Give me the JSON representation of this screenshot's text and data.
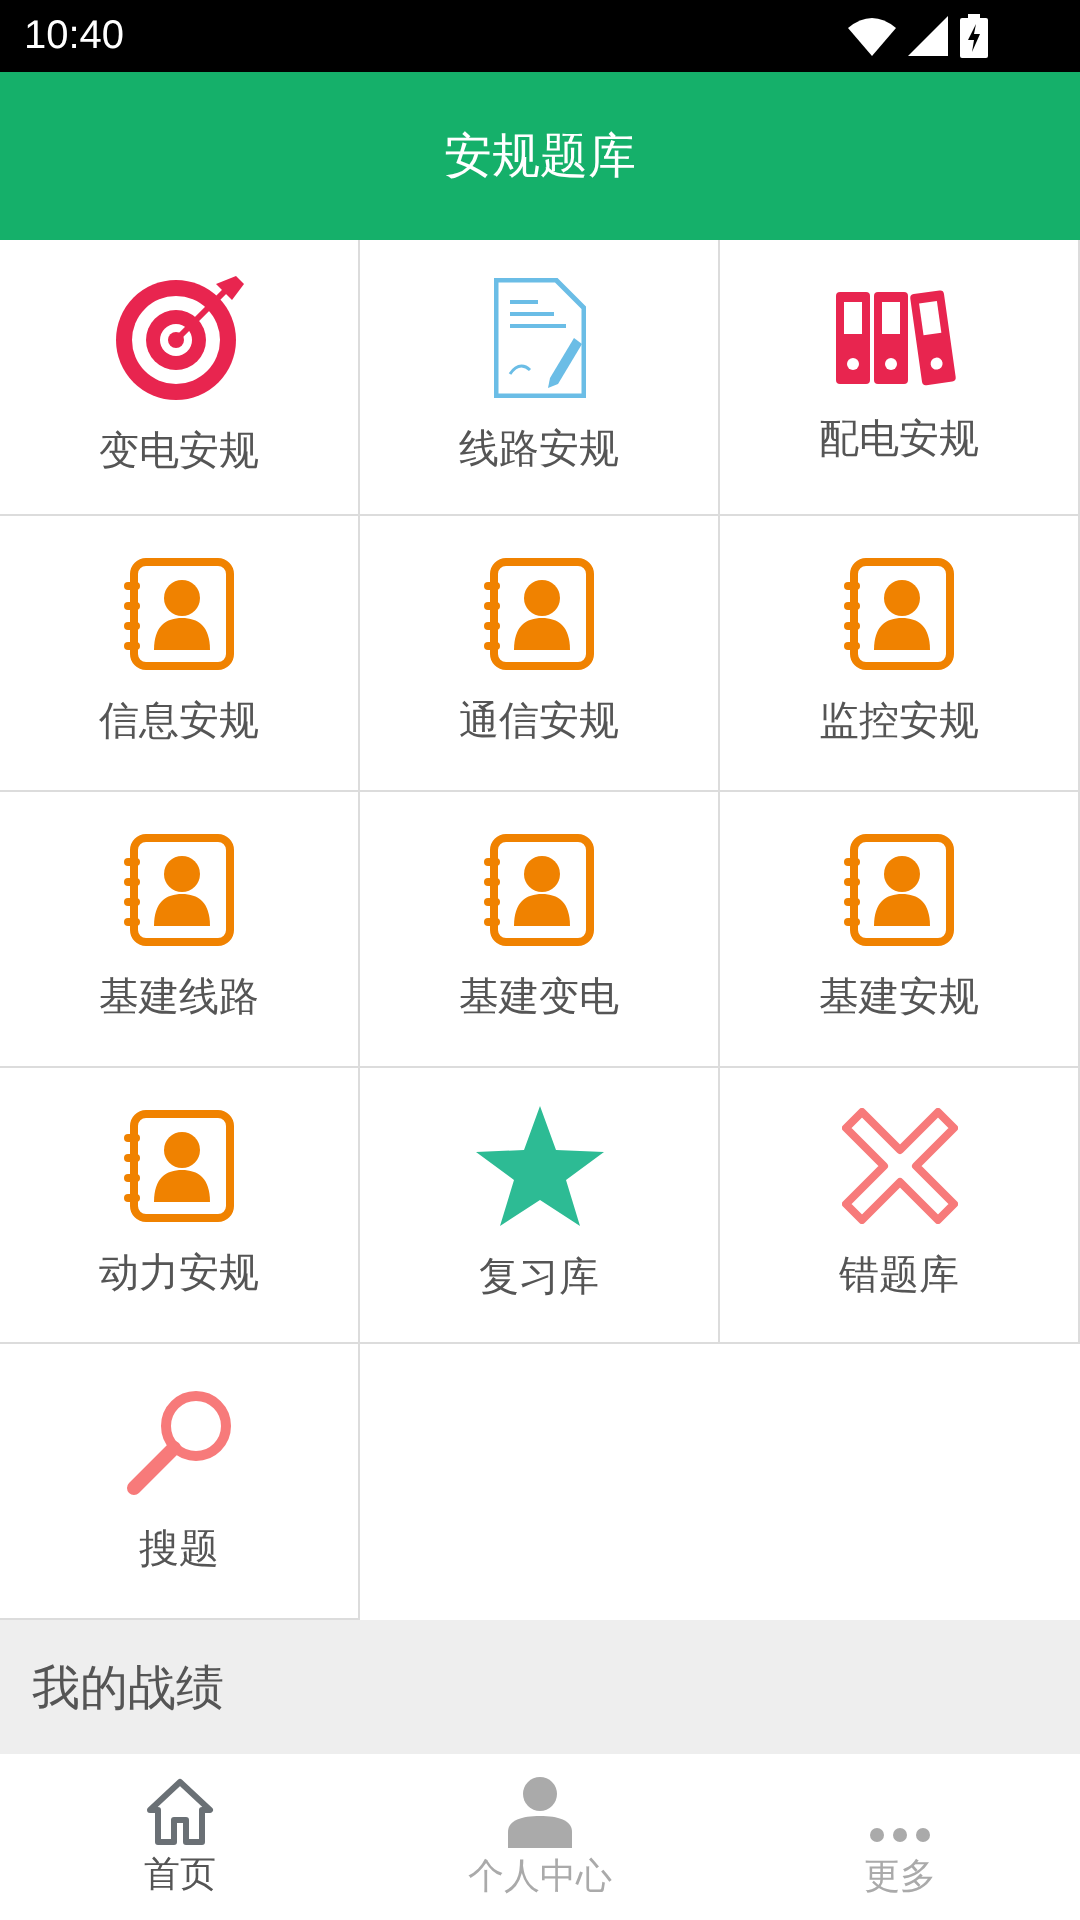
{
  "status_bar": {
    "time": "10:40"
  },
  "header": {
    "title": "安规题库"
  },
  "grid": [
    {
      "label": "变电安规",
      "kind": "target"
    },
    {
      "label": "线路安规",
      "kind": "document"
    },
    {
      "label": "配电安规",
      "kind": "binders"
    },
    {
      "label": "信息安规",
      "kind": "contact"
    },
    {
      "label": "通信安规",
      "kind": "contact"
    },
    {
      "label": "监控安规",
      "kind": "contact"
    },
    {
      "label": "基建线路",
      "kind": "contact"
    },
    {
      "label": "基建变电",
      "kind": "contact"
    },
    {
      "label": "基建安规",
      "kind": "contact"
    },
    {
      "label": "动力安规",
      "kind": "contact"
    },
    {
      "label": "复习库",
      "kind": "star"
    },
    {
      "label": "错题库",
      "kind": "cross"
    },
    {
      "label": "搜题",
      "kind": "search"
    }
  ],
  "section": {
    "title": "我的战绩"
  },
  "bottom_nav": [
    {
      "label": "首页",
      "kind": "home",
      "selected": true
    },
    {
      "label": "个人中心",
      "kind": "person",
      "selected": false
    },
    {
      "label": "更多",
      "kind": "more",
      "selected": false
    }
  ]
}
